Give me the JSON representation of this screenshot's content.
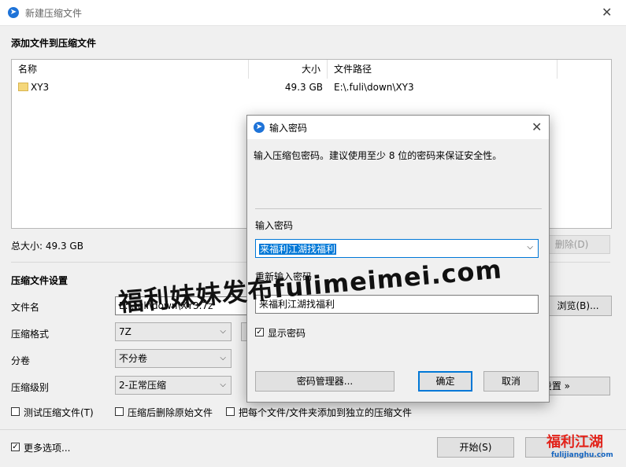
{
  "window": {
    "title": "新建压缩文件"
  },
  "add_section": {
    "title": "添加文件到压缩文件"
  },
  "file_list": {
    "columns": [
      "名称",
      "大小",
      "文件路径"
    ],
    "rows": [
      {
        "name": "XY3",
        "size": "49.3 GB",
        "path": "E:\\.fuli\\down\\XY3"
      }
    ]
  },
  "total_size": "总大小: 49.3 GB",
  "delete_button": "删除(D)",
  "settings_section": {
    "title": "压缩文件设置"
  },
  "form": {
    "filename_label": "文件名",
    "filename_value": "E:\\.fuli\\down\\XY3.7z",
    "browse_button": "浏览(B)...",
    "format_label": "压缩格式",
    "format_value": "7Z",
    "split_label": "分卷",
    "split_value": "不分卷",
    "level_label": "压缩级别",
    "level_value": "2-正常压缩",
    "settings_button": "设置 »"
  },
  "checkboxes": {
    "test": "测试压缩文件(T)",
    "delete_after": "压缩后删除原始文件",
    "separate": "把每个文件/文件夹添加到独立的压缩文件",
    "more_options": "更多选项..."
  },
  "start_button": "开始(S)",
  "password_dialog": {
    "title": "输入密码",
    "description": "输入压缩包密码。建议使用至少 8 位的密码来保证安全性。",
    "password_label": "输入密码",
    "password_value": "来福利江湖找福利",
    "reenter_label": "重新输入密码",
    "reenter_value": "来福利江湖找福利",
    "show_password": "显示密码",
    "manager_button": "密码管理器...",
    "ok_button": "确定",
    "cancel_button": "取消"
  },
  "watermark": {
    "text": "福利妹妹发布fulimeimei.com"
  },
  "logo": {
    "brand": "福利江湖",
    "domain": "fulijianghu.com"
  },
  "colors": {
    "accent": "#0078d7",
    "selection": "#0078d7",
    "folder": "#f5d77a",
    "logo_red": "#e2231a",
    "logo_blue": "#1565c0"
  }
}
